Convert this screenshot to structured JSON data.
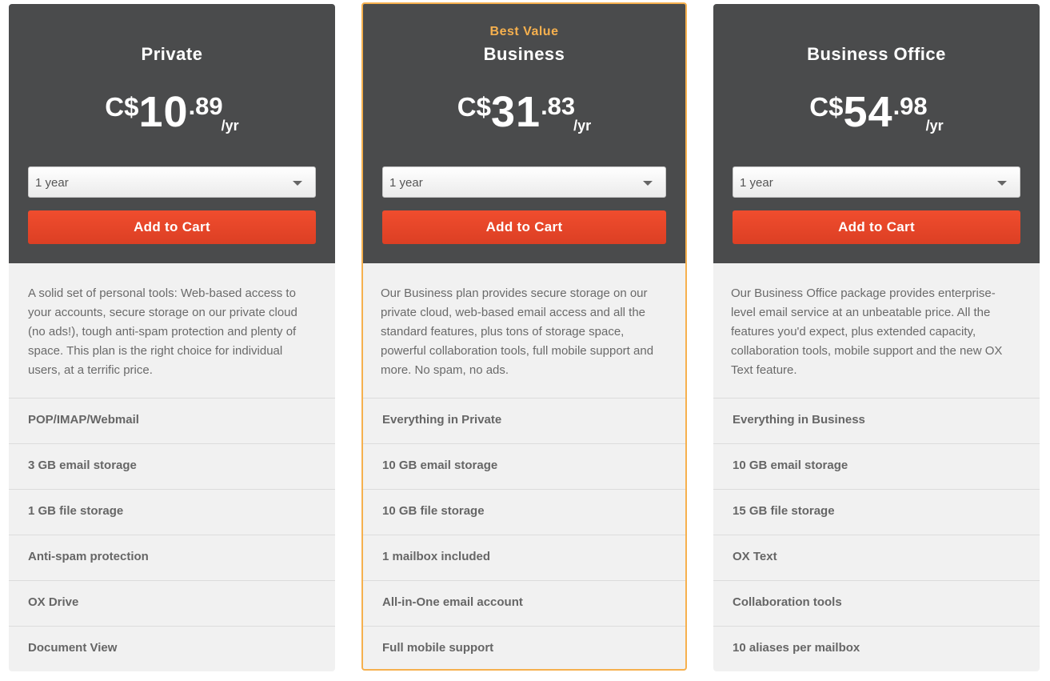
{
  "plans": [
    {
      "badge": "",
      "title": "Private",
      "currency": "C$",
      "price_int": "10",
      "price_dec": ".89",
      "period": "/yr",
      "term_selected": "1 year",
      "cart_label": "Add to Cart",
      "description": "A solid set of personal tools: Web-based access to your accounts, secure storage on our private cloud (no ads!), tough anti-spam protection and plenty of space. This plan is the right choice for individual users, at a terrific price.",
      "features": [
        "POP/IMAP/Webmail",
        "3 GB email storage",
        "1 GB file storage",
        "Anti-spam protection",
        "OX Drive",
        "Document View"
      ]
    },
    {
      "badge": "Best Value",
      "title": "Business",
      "currency": "C$",
      "price_int": "31",
      "price_dec": ".83",
      "period": "/yr",
      "term_selected": "1 year",
      "cart_label": "Add to Cart",
      "description": "Our Business plan provides secure storage on our private cloud, web-based email access and all the standard features, plus tons of storage space, powerful collaboration tools, full mobile support and more. No spam, no ads.",
      "features": [
        "Everything in Private",
        "10 GB email storage",
        "10 GB file storage",
        "1 mailbox included",
        "All-in-One email account",
        "Full mobile support"
      ]
    },
    {
      "badge": "",
      "title": "Business Office",
      "currency": "C$",
      "price_int": "54",
      "price_dec": ".98",
      "period": "/yr",
      "term_selected": "1 year",
      "cart_label": "Add to Cart",
      "description": "Our Business Office package provides enterprise-level email service at an unbeatable price. All the features you'd expect, plus extended capacity, collaboration tools, mobile support and the new OX Text feature.",
      "features": [
        "Everything in Business",
        "10 GB email storage",
        "15 GB file storage",
        "OX Text",
        "Collaboration tools",
        "10 aliases per mailbox"
      ]
    }
  ],
  "colors": {
    "header_bg": "#4a4b4c",
    "accent_highlight": "#f6b04e",
    "cart_button": "#e8472a",
    "body_bg": "#f1f1f1"
  },
  "icons": {
    "dropdown": "caret-down-icon"
  }
}
